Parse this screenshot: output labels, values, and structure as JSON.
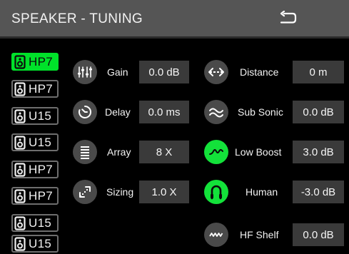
{
  "header": {
    "title": "SPEAKER - TUNING",
    "back_icon": "return-arrow-icon"
  },
  "colors": {
    "accent": "#13e23a",
    "bar": "#555555",
    "value_bg": "#3a3a3a",
    "circle": "#4a4a4a"
  },
  "speakers": [
    {
      "label": "HP7",
      "active": true
    },
    {
      "label": "HP7",
      "active": false
    },
    {
      "label": "U15",
      "active": false
    },
    {
      "label": "U15",
      "active": false
    },
    {
      "label": "HP7",
      "active": false
    },
    {
      "label": "HP7",
      "active": false
    },
    {
      "label": "U15",
      "active": false
    },
    {
      "label": "U15",
      "active": false
    }
  ],
  "left_params": [
    {
      "icon": "eq-sliders-icon",
      "label": "Gain",
      "value": "0.0 dB"
    },
    {
      "icon": "timer-icon",
      "label": "Delay",
      "value": "0.0 ms"
    },
    {
      "icon": "array-lines-icon",
      "label": "Array",
      "value": "8 X"
    },
    {
      "icon": "resize-arrow-icon",
      "label": "Sizing",
      "value": "1.0 X"
    }
  ],
  "right_params": [
    {
      "icon": "horizontal-arrows-icon",
      "label": "Distance",
      "value": "0 m",
      "on": false
    },
    {
      "icon": "double-wave-icon",
      "label": "Sub Sonic",
      "value": "0.0 dB",
      "on": false
    },
    {
      "icon": "hump-curve-icon",
      "label": "Low Boost",
      "value": "3.0 dB",
      "on": true
    },
    {
      "icon": "ear-icon",
      "label": "Human",
      "value": "-3.0 dB",
      "on": true
    },
    {
      "icon": "zigzag-wave-icon",
      "label": "HF Shelf",
      "value": "0.0 dB",
      "on": false
    }
  ]
}
